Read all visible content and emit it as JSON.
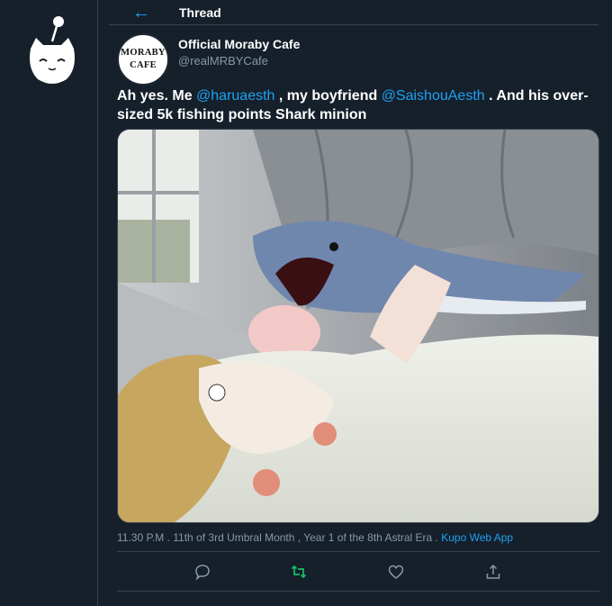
{
  "header": {
    "title": "Thread",
    "back_icon": "back-arrow-icon"
  },
  "author": {
    "name": "Official Moraby Cafe",
    "handle": "@realMRBYCafe",
    "avatar_line1": "MORABY",
    "avatar_line2": "CAFE"
  },
  "tweet": {
    "text_parts": [
      "Ah yes. Me ",
      "@haruaesth",
      " , my boyfriend ",
      "@SaishouAesth",
      " . And his over-sized 5k fishing points Shark minion"
    ],
    "timestamp": "11.30 P.M . 11th of 3rd Umbral Month , Year 1 of the 8th Astral Era . ",
    "source": "Kupo Web App"
  },
  "actions": [
    {
      "icon": "reply-icon"
    },
    {
      "icon": "retweet-icon",
      "color": "#17bf63"
    },
    {
      "icon": "like-icon"
    },
    {
      "icon": "share-icon"
    }
  ],
  "colors": {
    "background": "#15202b",
    "accent": "#1da1f2",
    "muted": "#8899a6",
    "border": "#38444d"
  }
}
